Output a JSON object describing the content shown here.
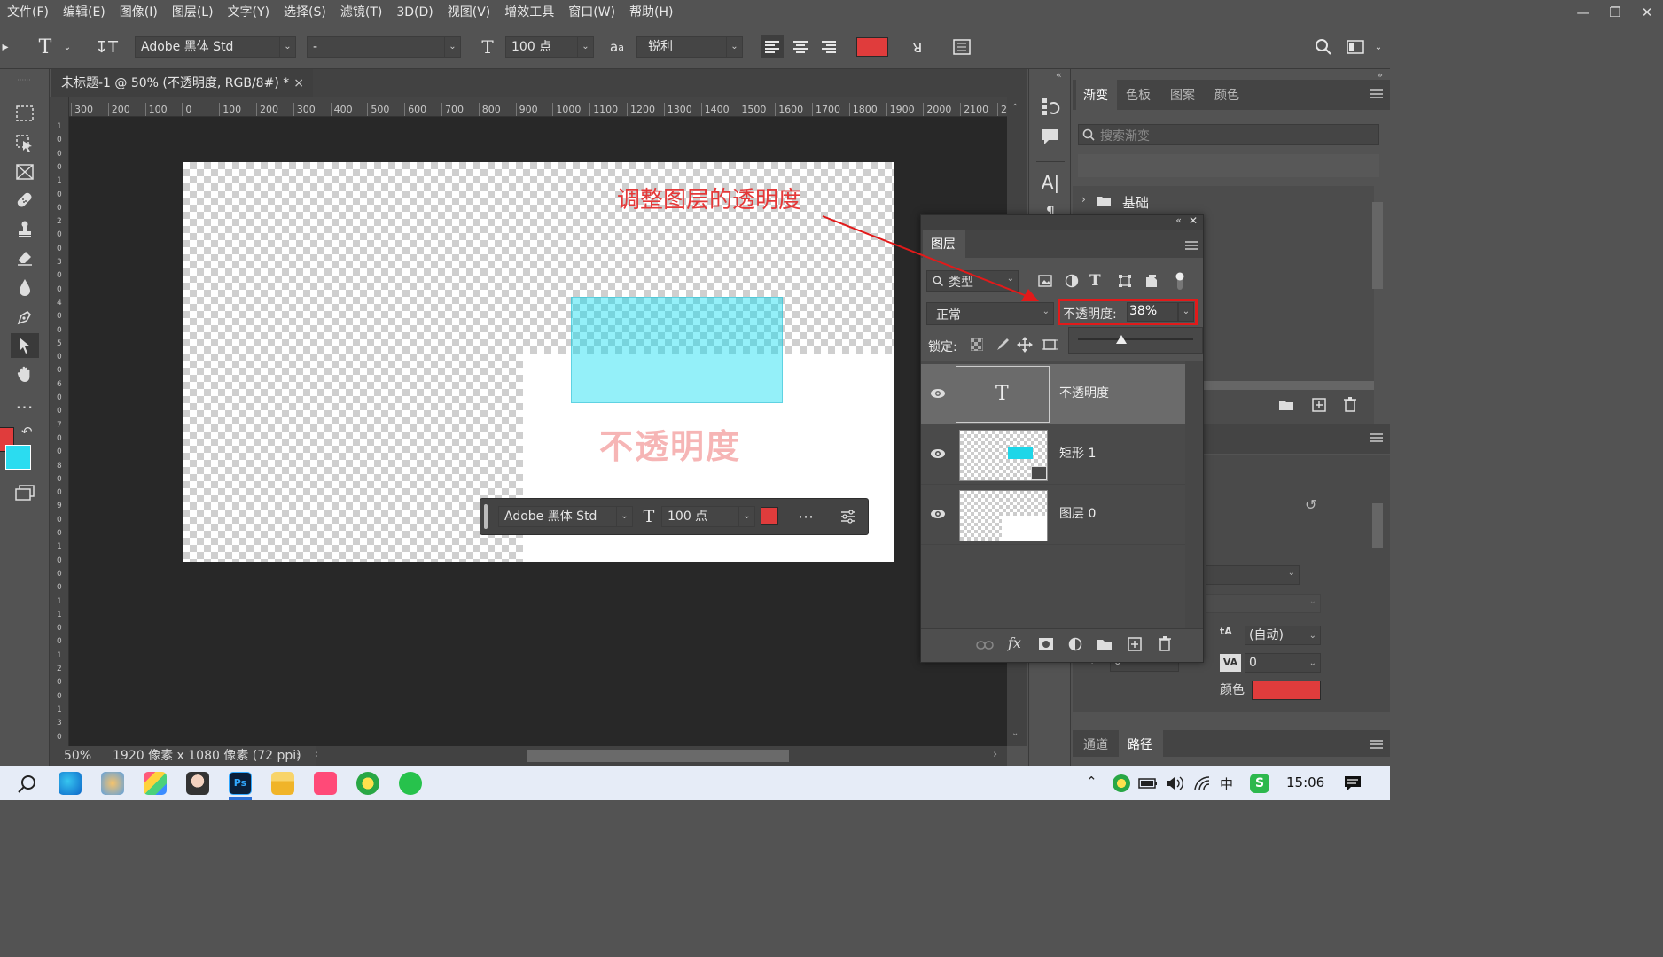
{
  "menu": [
    "文件(F)",
    "编辑(E)",
    "图像(I)",
    "图层(L)",
    "文字(Y)",
    "选择(S)",
    "滤镜(T)",
    "3D(D)",
    "视图(V)",
    "增效工具",
    "窗口(W)",
    "帮助(H)"
  ],
  "options": {
    "font_family": "Adobe 黑体 Std",
    "font_style": "-",
    "font_size": "100 点",
    "aa_label": "a",
    "aa_sub": "a",
    "antialias": "锐利",
    "text_color": "#e03c3c"
  },
  "document": {
    "tab_title": "未标题-1 @ 50% (不透明度, RGB/8#) *",
    "text_content": "不透明度",
    "rect_color": "#00dcf0",
    "annotation": "调整图层的透明度"
  },
  "ruler_h": [
    "300",
    "200",
    "100",
    "0",
    "100",
    "200",
    "300",
    "400",
    "500",
    "600",
    "700",
    "800",
    "900",
    "1000",
    "1100",
    "1200",
    "1300",
    "1400",
    "1500",
    "1600",
    "1700",
    "1800",
    "1900",
    "2000",
    "2100",
    "2"
  ],
  "ruler_v": [
    "1",
    "0",
    "0",
    "0",
    "1",
    "0",
    "0",
    "2",
    "0",
    "0",
    "3",
    "0",
    "0",
    "4",
    "0",
    "0",
    "5",
    "0",
    "0",
    "6",
    "0",
    "0",
    "7",
    "0",
    "0",
    "8",
    "0",
    "0",
    "9",
    "0",
    "0",
    "1",
    "0",
    "0",
    "0",
    "1",
    "1",
    "0",
    "0",
    "1",
    "2",
    "0",
    "0",
    "1",
    "3",
    "0",
    "0"
  ],
  "floating_bar": {
    "font_family": "Adobe 黑体 Std",
    "font_size": "100 点",
    "color": "#e03c3c"
  },
  "status": {
    "zoom": "50%",
    "info": "1920 像素 x 1080 像素 (72 ppi)"
  },
  "colors": {
    "foreground": "#e03c3c",
    "background": "#2bdcf0"
  },
  "right_panel": {
    "tabs": [
      "渐变",
      "色板",
      "图案",
      "颜色"
    ],
    "search_placeholder": "搜索渐变",
    "folder": "基础",
    "bottom_tabs": [
      "通道",
      "路径"
    ],
    "char_leading": "(自动)",
    "char_tracking": "0",
    "color_label": "颜色",
    "lower_small_field": "0"
  },
  "layers_panel": {
    "title": "图层",
    "filter": "类型",
    "blend": "正常",
    "opacity_label": "不透明度:",
    "opacity_value": "38%",
    "lock_label": "锁定:",
    "layers": [
      {
        "name": "不透明度",
        "type": "text",
        "selected": true
      },
      {
        "name": "矩形 1",
        "type": "shape",
        "selected": false
      },
      {
        "name": "图层 0",
        "type": "pixel",
        "selected": false
      }
    ]
  },
  "taskbar": {
    "time": "15:06",
    "ime": "中"
  }
}
